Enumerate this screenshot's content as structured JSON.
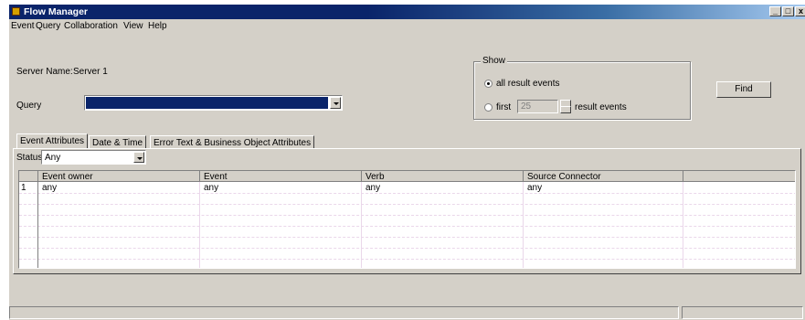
{
  "window": {
    "title": "Flow Manager",
    "controls": [
      "_",
      "□",
      "x"
    ]
  },
  "menu": [
    "Event",
    "Query",
    "Collaboration",
    "View",
    "Help"
  ],
  "server": {
    "label": "Server Name:",
    "value": "Server 1"
  },
  "query": {
    "label": "Query",
    "value": ""
  },
  "show": {
    "group_label": "Show",
    "all_label": "all result events",
    "first_label": "first",
    "first_value": "25",
    "result_label": "result events",
    "selected": "all"
  },
  "find_button": "Find",
  "tabs": [
    "Event Attributes",
    "Date & Time",
    "Error Text & Business Object Attributes"
  ],
  "status": {
    "label": "Status:",
    "value": "Any"
  },
  "grid": {
    "columns": [
      "Event owner",
      "Event",
      "Verb",
      "Source Connector",
      ""
    ],
    "rows": [
      {
        "num": "1",
        "cells": [
          "any",
          "any",
          "any",
          "any",
          ""
        ]
      }
    ]
  },
  "colors": {
    "title_start": "#0a246a",
    "title_end": "#a6caf0",
    "query_fill": "#0a246a",
    "face": "#d4d0c8"
  }
}
